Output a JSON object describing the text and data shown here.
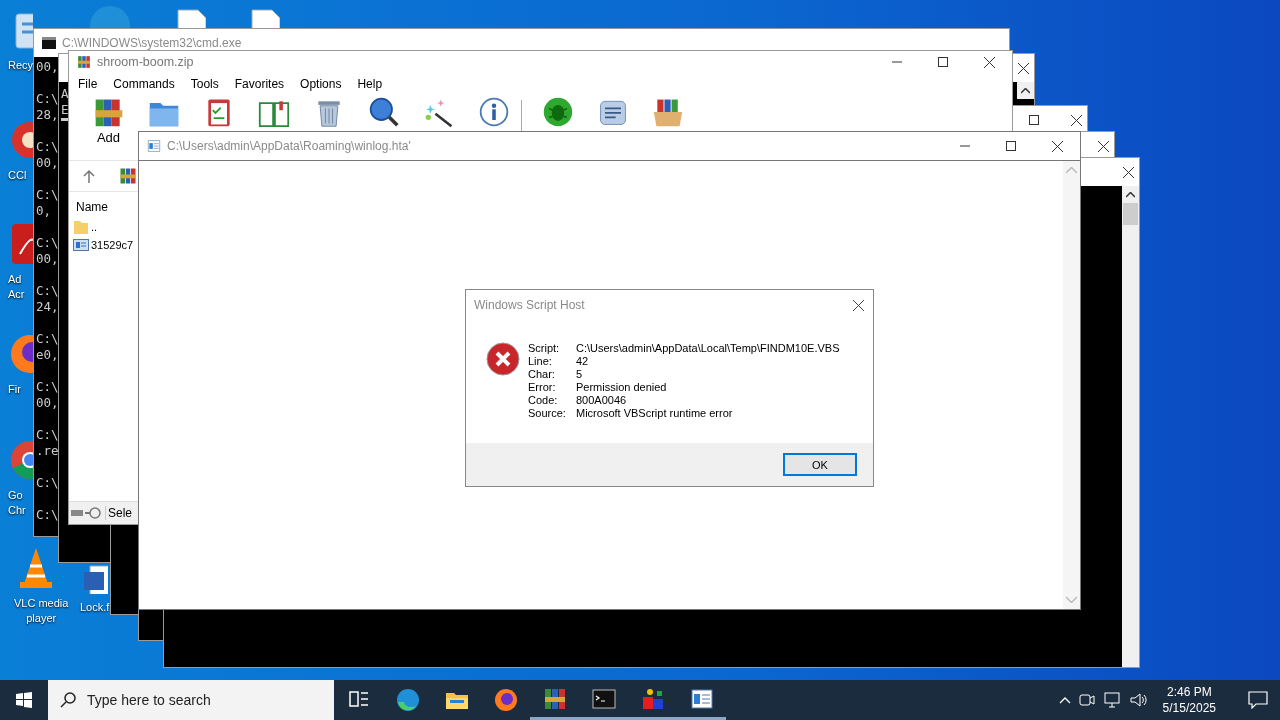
{
  "desktop_icons": [
    {
      "kind": "recycle-bin",
      "lines": [
        "Recy"
      ]
    },
    {
      "kind": "edge"
    },
    {
      "kind": "document"
    },
    {
      "kind": "document"
    },
    {
      "kind": "ccleaner",
      "lines": [
        "CCl"
      ]
    },
    {
      "kind": "acrobat",
      "lines": [
        "Ad",
        "Acr"
      ]
    },
    {
      "kind": "firefox",
      "lines": [
        "Fir"
      ]
    },
    {
      "kind": "chrome",
      "lines": [
        "Go",
        "Chr"
      ]
    },
    {
      "kind": "vlc",
      "lines": [
        "VLC media",
        "player"
      ]
    },
    {
      "kind": "word",
      "lines": [
        "Lock.f"
      ]
    }
  ],
  "cmd_window": {
    "title": "C:\\WINDOWS\\system32\\cmd.exe",
    "blocks": [
      [
        "00,"
      ],
      [
        "C:\\",
        "28,"
      ],
      [
        "C:\\",
        "00,"
      ],
      [
        "C:\\",
        "0,"
      ],
      [
        "C:\\",
        "00,"
      ],
      [
        "C:\\",
        "24,"
      ],
      [
        "C:\\",
        "e0,"
      ],
      [
        "C:\\",
        "00,"
      ],
      [
        "C:\\",
        ".re"
      ],
      [
        "C:\\"
      ],
      [
        "C:\\"
      ]
    ]
  },
  "console_windows": [
    {
      "blocks": [
        [
          "A",
          "E"
        ]
      ]
    }
  ],
  "winrar_window": {
    "title": "shroom-boom.zip",
    "menu": [
      "File",
      "Commands",
      "Tools",
      "Favorites",
      "Options",
      "Help"
    ],
    "toolbar": [
      {
        "label": "Add"
      }
    ],
    "columns": [
      "Name"
    ],
    "files": [
      {
        "kind": "folder",
        "name": ".."
      },
      {
        "kind": "file",
        "name": "31529c7"
      }
    ],
    "status": "Sele"
  },
  "hta_window": {
    "title": "C:\\Users\\admin\\AppData\\Roaming\\winlog.hta'"
  },
  "dialog": {
    "title": "Windows Script Host",
    "rows": [
      {
        "label": "Script:",
        "value": "C:\\Users\\admin\\AppData\\Local\\Temp\\FINDM10E.VBS"
      },
      {
        "label": "Line:",
        "value": "42"
      },
      {
        "label": "Char:",
        "value": "5"
      },
      {
        "label": "Error:",
        "value": "Permission denied"
      },
      {
        "label": "Code:",
        "value": "800A0046"
      },
      {
        "label": "Source:",
        "value": "Microsoft VBScript runtime error"
      }
    ],
    "button": "OK"
  },
  "taskbar": {
    "search": {
      "placeholder": "Type here to search"
    },
    "apps": [
      {
        "kind": "task-view",
        "running": false
      },
      {
        "kind": "edge",
        "running": false
      },
      {
        "kind": "explorer",
        "running": false
      },
      {
        "kind": "firefox",
        "running": false
      },
      {
        "kind": "winrar",
        "running": true
      },
      {
        "kind": "cmd",
        "running": true
      },
      {
        "kind": "app",
        "running": true
      },
      {
        "kind": "hta",
        "running": true
      }
    ],
    "time": "2:46 PM",
    "date": "5/15/2025"
  }
}
